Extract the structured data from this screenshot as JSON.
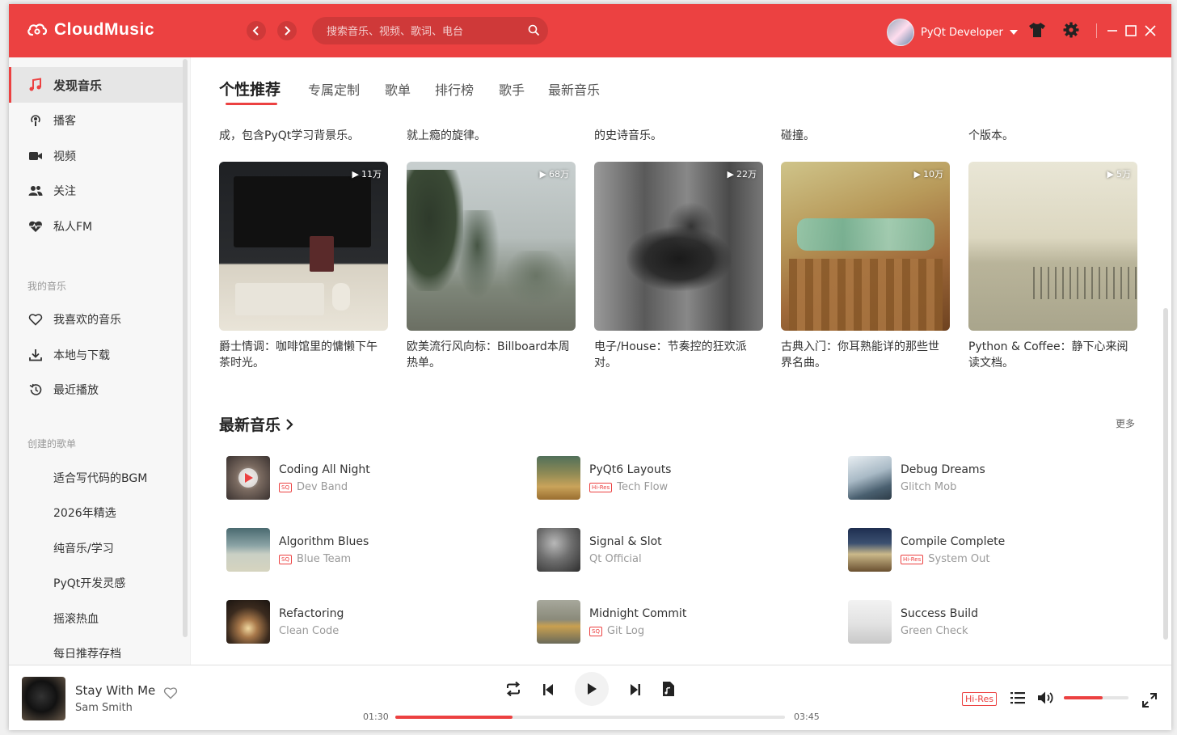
{
  "app": {
    "title": "CloudMusic"
  },
  "search": {
    "placeholder": "搜索音乐、视频、歌词、电台"
  },
  "user": {
    "name": "PyQt Developer"
  },
  "colors": {
    "accent": "#ec4141"
  },
  "sidebar": {
    "items": [
      {
        "label": "发现音乐",
        "icon": "music-note-icon",
        "active": true
      },
      {
        "label": "播客",
        "icon": "podcast-icon"
      },
      {
        "label": "视频",
        "icon": "video-camera-icon"
      },
      {
        "label": "关注",
        "icon": "users-icon"
      },
      {
        "label": "私人FM",
        "icon": "heart-pulse-icon"
      }
    ],
    "my_music_title": "我的音乐",
    "my_music": [
      {
        "label": "我喜欢的音乐",
        "icon": "heart-outline-icon"
      },
      {
        "label": "本地与下载",
        "icon": "download-icon"
      },
      {
        "label": "最近播放",
        "icon": "history-icon"
      }
    ],
    "playlists_title": "创建的歌单",
    "playlists": [
      "适合写代码的BGM",
      "2026年精选",
      "纯音乐/学习",
      "PyQt开发灵感",
      "摇滚热血",
      "每日推荐存档"
    ]
  },
  "tabs": [
    "个性推荐",
    "专属定制",
    "歌单",
    "排行榜",
    "歌手",
    "最新音乐"
  ],
  "partial_cards": [
    "成，包含PyQt学习背景乐。",
    "就上瘾的旋律。",
    "的史诗音乐。",
    "碰撞。",
    "个版本。"
  ],
  "cards": [
    {
      "plays": "11万",
      "title": "爵士情调：咖啡馆里的慵懒下午茶时光。"
    },
    {
      "plays": "68万",
      "title": "欧美流行风向标：Billboard本周热单。"
    },
    {
      "plays": "22万",
      "title": "电子/House：节奏控的狂欢派对。"
    },
    {
      "plays": "10万",
      "title": "古典入门：你耳熟能详的那些世界名曲。"
    },
    {
      "plays": "5万",
      "title": "Python & Coffee：静下心来阅读文档。"
    }
  ],
  "new_music": {
    "title": "最新音乐",
    "more": "更多",
    "songs": [
      {
        "name": "Coding All Night",
        "artist": "Dev Band",
        "badge": "SQ"
      },
      {
        "name": "PyQt6 Layouts",
        "artist": "Tech Flow",
        "badge": "Hi-Res"
      },
      {
        "name": "Debug Dreams",
        "artist": "Glitch Mob",
        "badge": ""
      },
      {
        "name": "Algorithm Blues",
        "artist": "Blue Team",
        "badge": "SQ"
      },
      {
        "name": "Signal & Slot",
        "artist": "Qt Official",
        "badge": ""
      },
      {
        "name": "Compile Complete",
        "artist": "System Out",
        "badge": "Hi-Res"
      },
      {
        "name": "Refactoring",
        "artist": "Clean Code",
        "badge": ""
      },
      {
        "name": "Midnight Commit",
        "artist": "Git Log",
        "badge": "SQ"
      },
      {
        "name": "Success Build",
        "artist": "Green Check",
        "badge": ""
      }
    ]
  },
  "player": {
    "song": "Stay With Me",
    "artist": "Sam Smith",
    "current_time": "01:30",
    "total_time": "03:45",
    "progress": 0.3,
    "quality": "Hi-Res",
    "volume": 0.6
  }
}
